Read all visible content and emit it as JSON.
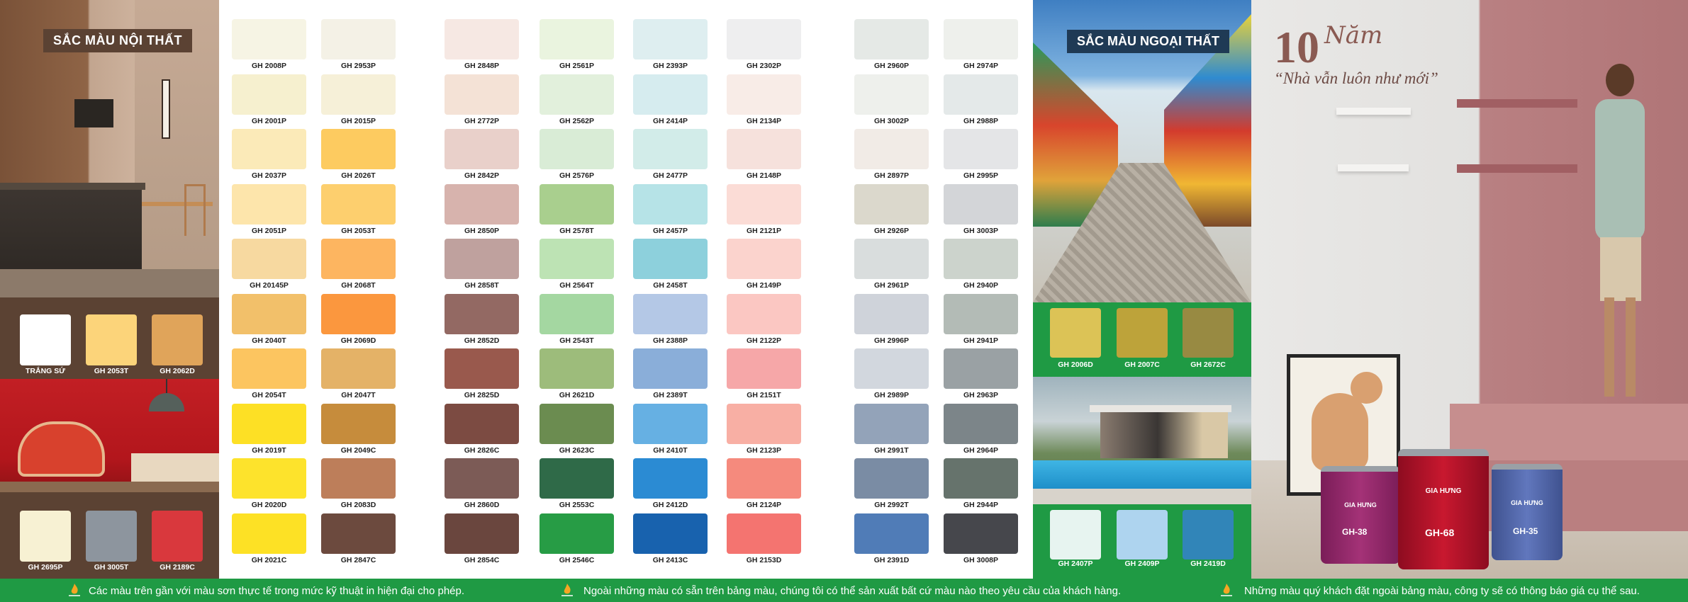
{
  "interior": {
    "title": "SẮC MÀU NỘI THẤT",
    "top_swatches": [
      {
        "code": "TRẮNG SỨ",
        "color": "#ffffff"
      },
      {
        "code": "GH 2053T",
        "color": "#fcd47a"
      },
      {
        "code": "GH 2062D",
        "color": "#e0a45a"
      }
    ],
    "bottom_swatches": [
      {
        "code": "GH 2695P",
        "color": "#f7f1d3"
      },
      {
        "code": "GH 3005T",
        "color": "#8d959e"
      },
      {
        "code": "GH 2189C",
        "color": "#d9383d"
      }
    ]
  },
  "palette": {
    "columns": [
      [
        {
          "code": "GH 2008P",
          "color": "#f6f4e4"
        },
        {
          "code": "GH 2001P",
          "color": "#f6f0cf"
        },
        {
          "code": "GH 2037P",
          "color": "#fbeab8"
        },
        {
          "code": "GH 2051P",
          "color": "#fde5ab"
        },
        {
          "code": "GH 20145P",
          "color": "#f7d9a0"
        },
        {
          "code": "GH 2040T",
          "color": "#f2c06a"
        },
        {
          "code": "GH 2054T",
          "color": "#fcc560"
        },
        {
          "code": "GH 2019T",
          "color": "#fde025"
        },
        {
          "code": "GH 2020D",
          "color": "#fde32c"
        },
        {
          "code": "GH 2021C",
          "color": "#fde125"
        }
      ],
      [
        {
          "code": "GH 2953P",
          "color": "#f4f1e6"
        },
        {
          "code": "GH 2015P",
          "color": "#f6f0d8"
        },
        {
          "code": "GH 2026T",
          "color": "#fdcb60"
        },
        {
          "code": "GH 2053T",
          "color": "#fdcf6e"
        },
        {
          "code": "GH 2068T",
          "color": "#fdb560"
        },
        {
          "code": "GH 2069D",
          "color": "#fb973e"
        },
        {
          "code": "GH 2047T",
          "color": "#e4b267"
        },
        {
          "code": "GH 2049C",
          "color": "#c68c3c"
        },
        {
          "code": "GH 2083D",
          "color": "#bd7e5a"
        },
        {
          "code": "GH 2847C",
          "color": "#6c4a3e"
        }
      ],
      [
        {
          "code": "GH 2848P",
          "color": "#f6e8e3"
        },
        {
          "code": "GH 2772P",
          "color": "#f4e2d6"
        },
        {
          "code": "GH 2842P",
          "color": "#e9d0ca"
        },
        {
          "code": "GH 2850P",
          "color": "#d7b3ad"
        },
        {
          "code": "GH 2858T",
          "color": "#bfa19e"
        },
        {
          "code": "GH 2852D",
          "color": "#936963"
        },
        {
          "code": "GH 2825D",
          "color": "#99594d"
        },
        {
          "code": "GH 2826C",
          "color": "#7c4b42"
        },
        {
          "code": "GH 2860D",
          "color": "#7c5b56"
        },
        {
          "code": "GH 2854C",
          "color": "#6a463e"
        }
      ],
      [
        {
          "code": "GH 2561P",
          "color": "#eaf4df"
        },
        {
          "code": "GH 2562P",
          "color": "#e2f0dc"
        },
        {
          "code": "GH 2576P",
          "color": "#d9ecd6"
        },
        {
          "code": "GH 2578T",
          "color": "#a9cf8e"
        },
        {
          "code": "GH 2564T",
          "color": "#bde3b4"
        },
        {
          "code": "GH 2543T",
          "color": "#a4d7a1"
        },
        {
          "code": "GH 2621D",
          "color": "#9dbc7b"
        },
        {
          "code": "GH 2623C",
          "color": "#6b8c50"
        },
        {
          "code": "GH 2553C",
          "color": "#2f6a48"
        },
        {
          "code": "GH 2546C",
          "color": "#279c45"
        }
      ],
      [
        {
          "code": "GH 2393P",
          "color": "#deeef0"
        },
        {
          "code": "GH 2414P",
          "color": "#d6ecef"
        },
        {
          "code": "GH 2477P",
          "color": "#d2ece9"
        },
        {
          "code": "GH 2457P",
          "color": "#b6e3e7"
        },
        {
          "code": "GH 2458T",
          "color": "#8dd0dc"
        },
        {
          "code": "GH 2388P",
          "color": "#b4c8e6"
        },
        {
          "code": "GH 2389T",
          "color": "#8aaed9"
        },
        {
          "code": "GH 2410T",
          "color": "#66b0e3"
        },
        {
          "code": "GH 2412D",
          "color": "#2b8bd3"
        },
        {
          "code": "GH 2413C",
          "color": "#1862ae"
        }
      ],
      [
        {
          "code": "GH 2302P",
          "color": "#eeeeef"
        },
        {
          "code": "GH 2134P",
          "color": "#f8ece7"
        },
        {
          "code": "GH 2148P",
          "color": "#f6e1dc"
        },
        {
          "code": "GH 2121P",
          "color": "#fbdcd6"
        },
        {
          "code": "GH 2149P",
          "color": "#fbd3cd"
        },
        {
          "code": "GH 2122P",
          "color": "#fbc7c2"
        },
        {
          "code": "GH 2151T",
          "color": "#f6a7a8"
        },
        {
          "code": "GH 2123P",
          "color": "#f8afa4"
        },
        {
          "code": "GH 2124P",
          "color": "#f58a7d"
        },
        {
          "code": "GH 2153D",
          "color": "#f47470"
        }
      ],
      [
        {
          "code": "GH 2960P",
          "color": "#e5e9e6"
        },
        {
          "code": "GH 3002P",
          "color": "#eef0ec"
        },
        {
          "code": "GH 2897P",
          "color": "#f1ebe6"
        },
        {
          "code": "GH 2926P",
          "color": "#dbd8cc"
        },
        {
          "code": "GH 2961P",
          "color": "#d9dddd"
        },
        {
          "code": "GH 2996P",
          "color": "#cfd3da"
        },
        {
          "code": "GH 2989P",
          "color": "#d2d7de"
        },
        {
          "code": "GH 2991T",
          "color": "#93a3b9"
        },
        {
          "code": "GH 2992T",
          "color": "#7a8ca4"
        },
        {
          "code": "GH 2391D",
          "color": "#507cb7"
        }
      ],
      [
        {
          "code": "GH 2974P",
          "color": "#eef0ec"
        },
        {
          "code": "GH 2988P",
          "color": "#e4e9e9"
        },
        {
          "code": "GH 2995P",
          "color": "#e4e5e7"
        },
        {
          "code": "GH 3003P",
          "color": "#d3d5d8"
        },
        {
          "code": "GH 2940P",
          "color": "#ccd3cc"
        },
        {
          "code": "GH 2941P",
          "color": "#b3bbb6"
        },
        {
          "code": "GH 2963P",
          "color": "#9aa1a4"
        },
        {
          "code": "GH 2964P",
          "color": "#7c8589"
        },
        {
          "code": "GH 2944P",
          "color": "#66736c"
        },
        {
          "code": "GH 3008P",
          "color": "#46474c"
        }
      ]
    ]
  },
  "exterior": {
    "title": "SẮC MÀU NGOẠI THẤT",
    "top_swatches": [
      {
        "code": "GH 2006D",
        "color": "#dcc356"
      },
      {
        "code": "GH 2007C",
        "color": "#bda33a"
      },
      {
        "code": "GH 2672C",
        "color": "#988a42"
      }
    ],
    "bottom_swatches": [
      {
        "code": "GH 2407P",
        "color": "#e7f4f0"
      },
      {
        "code": "GH 2409P",
        "color": "#aed4ef"
      },
      {
        "code": "GH 2419D",
        "color": "#3185b8"
      }
    ]
  },
  "promo": {
    "number": "10",
    "script_word": "Năm",
    "slogan": "“Nhà vẫn luôn như mới”",
    "cans": [
      {
        "brand": "GIA HƯNG",
        "name": "GH-38",
        "color": "#9c2a72"
      },
      {
        "brand": "GIA HƯNG",
        "name": "GH-68",
        "color": "#b8102a"
      },
      {
        "brand": "GIA HƯNG",
        "name": "GH-35",
        "color": "#5a6fb3"
      }
    ]
  },
  "footer": {
    "notes": [
      "Các màu trên gần với màu sơn thực tế trong mức kỹ thuật in hiện đại cho phép.",
      "Ngoài những màu có sẵn trên bảng màu, chúng tôi có thể sản xuất bất cứ màu nào theo yêu cầu của khách hàng.",
      "Những màu quý khách đặt ngoài bảng màu, công ty sẽ có thông báo giá cụ thể sau."
    ]
  }
}
